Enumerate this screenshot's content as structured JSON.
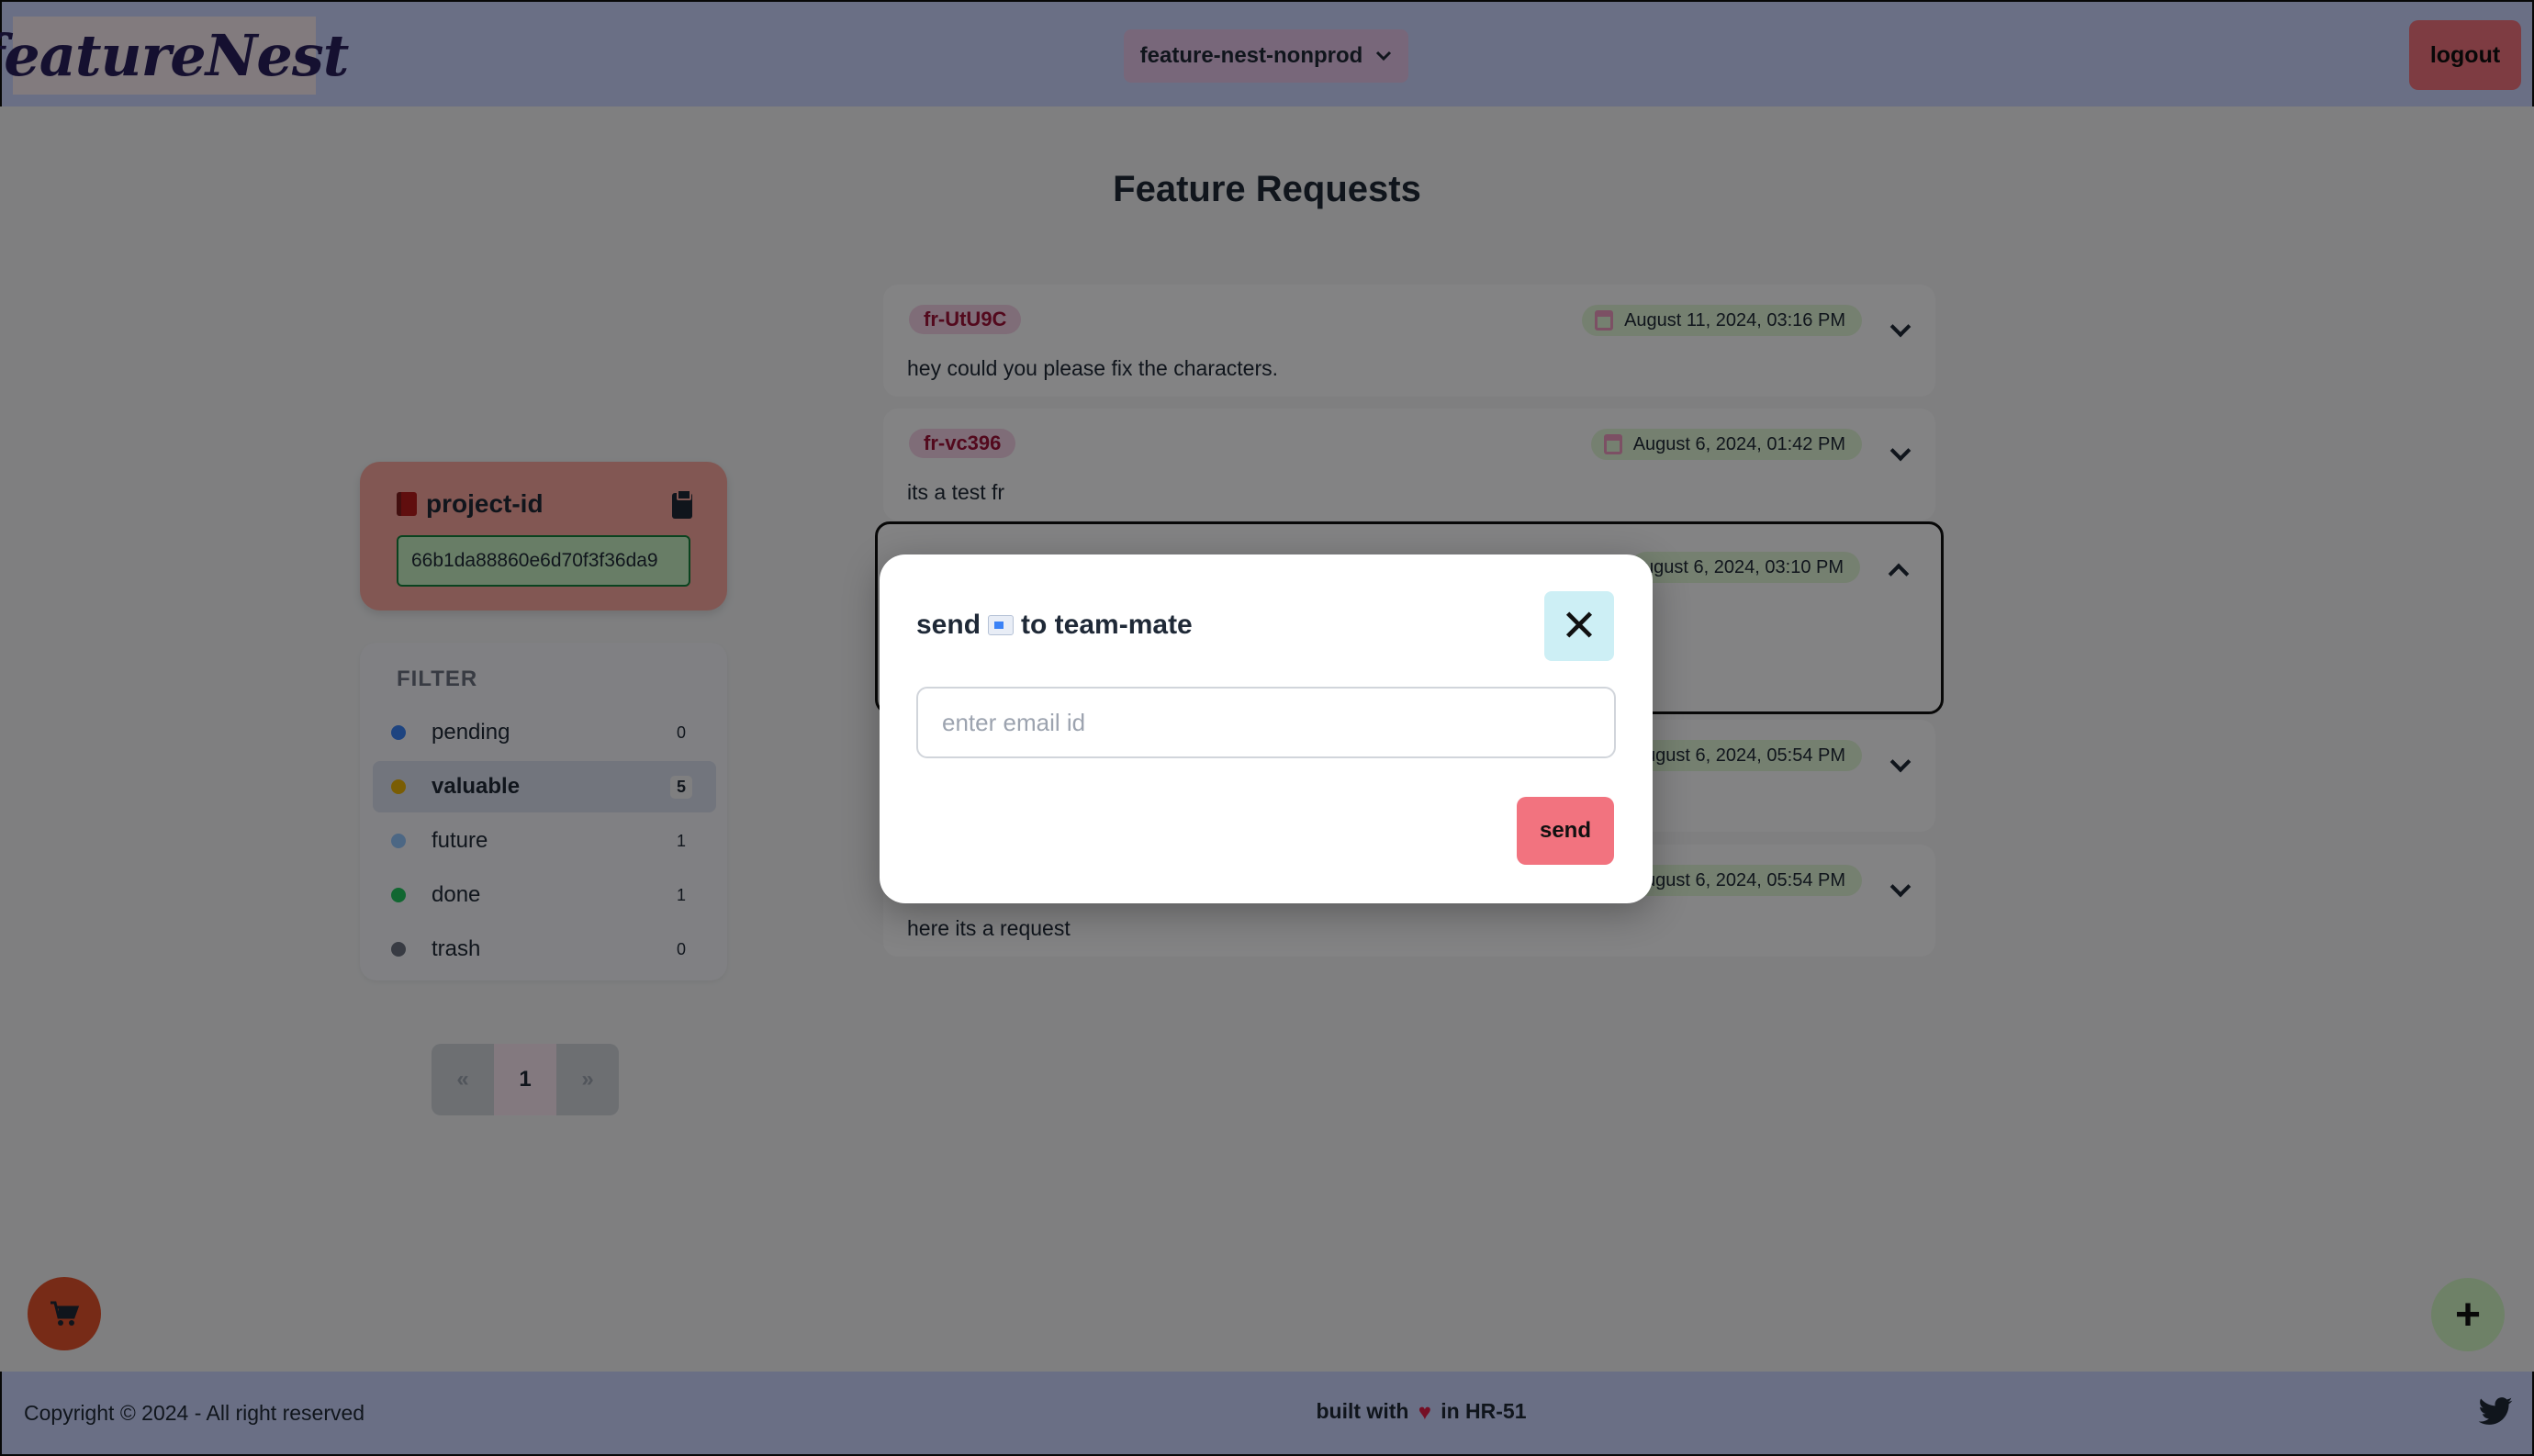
{
  "navbar": {
    "logo_text": "featureNest",
    "project_selector": "feature-nest-nonprod",
    "logout_label": "logout"
  },
  "main": {
    "title": "Feature Requests"
  },
  "project_card": {
    "label": "project-id",
    "id_value": "66b1da88860e6d70f3f36da9"
  },
  "filter": {
    "label": "FILTER",
    "items": [
      {
        "label": "pending",
        "count": "0",
        "color": "#3b82f6"
      },
      {
        "label": "valuable",
        "count": "5",
        "color": "#eab308"
      },
      {
        "label": "future",
        "count": "1",
        "color": "#93c5fd"
      },
      {
        "label": "done",
        "count": "1",
        "color": "#22c55e"
      },
      {
        "label": "trash",
        "count": "0",
        "color": "#6b7280"
      }
    ],
    "active_item": "valuable"
  },
  "pagination": {
    "prev": "«",
    "current": "1",
    "next": "»"
  },
  "requests": [
    {
      "id": "fr-UtU9C",
      "text": "hey could you please fix the characters.",
      "date": "August 11, 2024, 03:16 PM"
    },
    {
      "id": "fr-vc396",
      "text": "its a test fr",
      "date": "August 6, 2024, 01:42 PM"
    },
    {
      "id": "",
      "text": "",
      "date": "ugust 6, 2024, 03:10 PM"
    },
    {
      "id": "",
      "text": "",
      "date": "ugust 6, 2024, 05:54 PM"
    },
    {
      "id": "",
      "text": "here its a request",
      "date": "ugust 6, 2024, 05:54 PM"
    }
  ],
  "modal": {
    "title_before": "send",
    "title_after": "to team-mate",
    "close_symbol": "✕",
    "email_placeholder": "enter email id",
    "email_value": "",
    "send_label": "send"
  },
  "footer": {
    "copyright": "Copyright © 2024 - All right reserved",
    "built_before": "built with",
    "built_after": "in HR-51"
  },
  "fab": {
    "add_symbol": "+"
  },
  "colors": {
    "navbar_bg": "#cbd5ff",
    "accent_red": "#f2737f",
    "overlay": "rgba(0,0,0,0.48)"
  },
  "icons": [
    "chevron-down-icon",
    "book-icon",
    "clipboard-icon",
    "calendar-icon",
    "chevron-up-icon",
    "close-icon",
    "envelope-icon",
    "cart-icon",
    "plus-icon",
    "heart-icon",
    "twitter-icon"
  ]
}
